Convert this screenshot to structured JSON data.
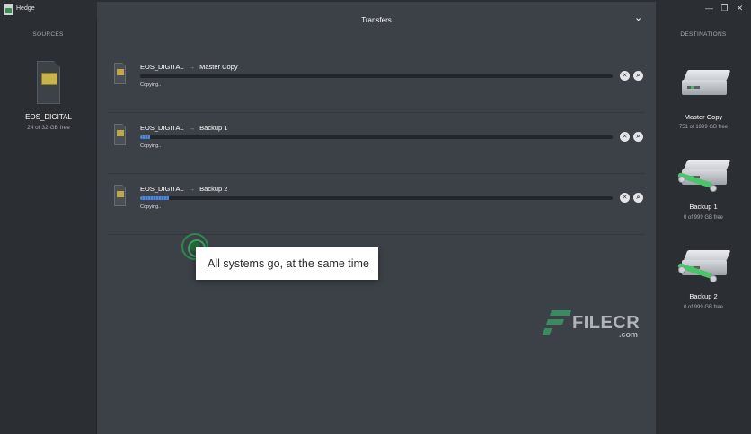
{
  "window": {
    "title": "Hedge",
    "minimize": "—",
    "maximize": "❐",
    "close": "✕"
  },
  "sources": {
    "label": "SOURCES",
    "card": {
      "name": "EOS_DIGITAL",
      "free": "24 of 32 GB free"
    }
  },
  "transfers": {
    "title": "Transfers",
    "collapse_icon": "⌄",
    "items": [
      {
        "source": "EOS_DIGITAL",
        "arrow": "→",
        "destination": "Master Copy",
        "status": "Copying..",
        "progress": 0.0
      },
      {
        "source": "EOS_DIGITAL",
        "arrow": "→",
        "destination": "Backup 1",
        "status": "Copying..",
        "progress": 0.02
      },
      {
        "source": "EOS_DIGITAL",
        "arrow": "→",
        "destination": "Backup 2",
        "status": "Copying..",
        "progress": 0.06
      }
    ],
    "cancel_icon": "✕",
    "reveal_icon": "⌕"
  },
  "tooltip": {
    "text": "All systems go, at the same time"
  },
  "watermark": {
    "brand": "FILECR",
    "suffix": ".com"
  },
  "destinations": {
    "label": "DESTINATIONS",
    "items": [
      {
        "name": "Master Copy",
        "free": "751 of 1999 GB free",
        "network": false
      },
      {
        "name": "Backup 1",
        "free": "0 of 999 GB free",
        "network": true
      },
      {
        "name": "Backup 2",
        "free": "0 of 999 GB free",
        "network": true
      }
    ]
  },
  "colors": {
    "accent_blue": "#4f86d8",
    "accent_green": "#3fbd5f",
    "panel": "#3c4047",
    "sidebar": "#2b2e33"
  }
}
